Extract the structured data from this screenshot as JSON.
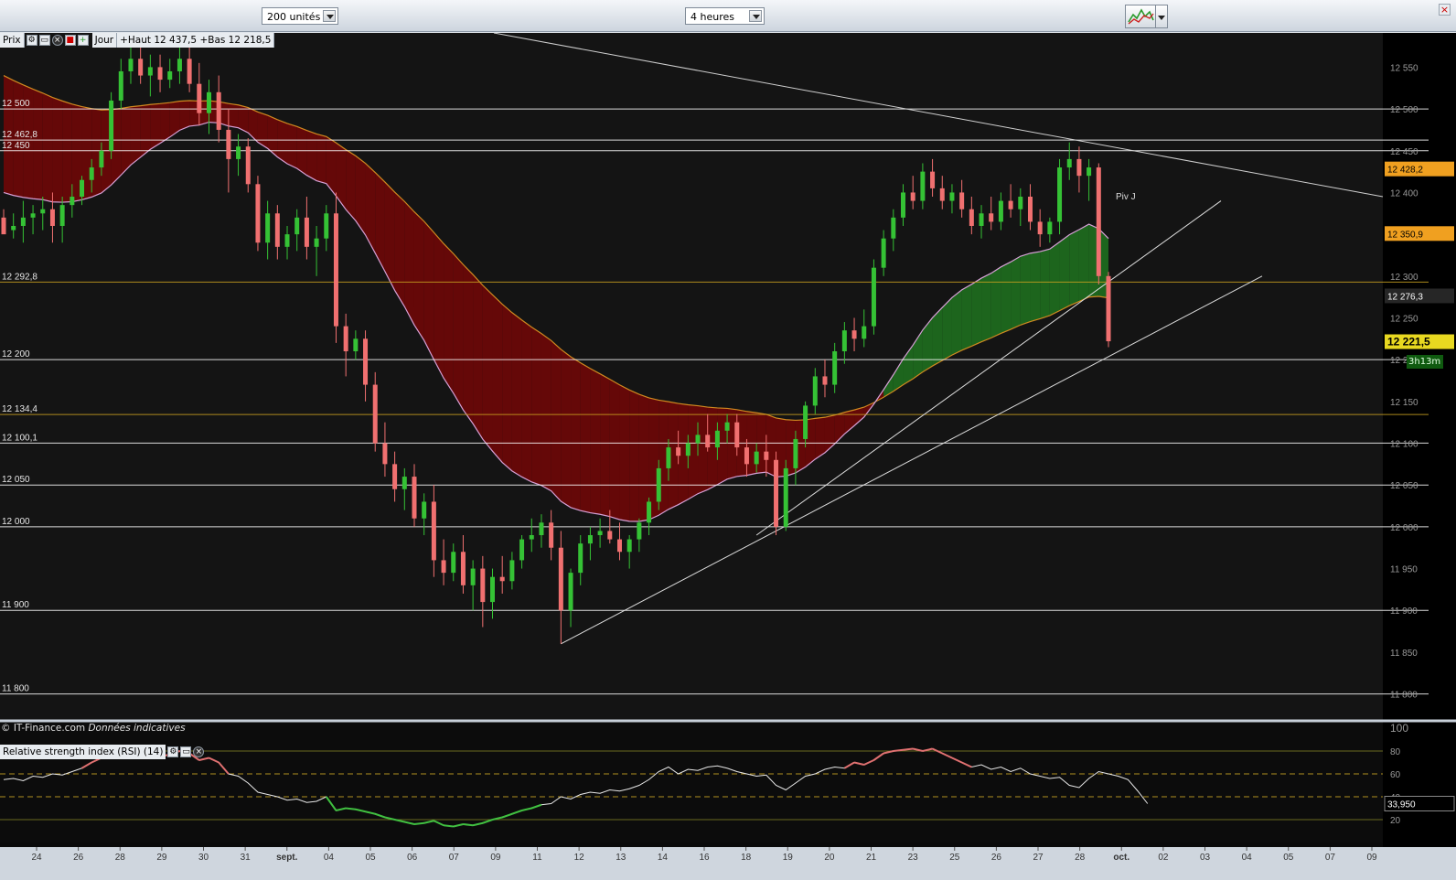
{
  "toolbar": {
    "units_select": "200 unités",
    "period_select": "4 heures",
    "close_label": "×"
  },
  "legend": {
    "price_label": "Prix",
    "period": "Jour",
    "high_low": "+Haut 12 437,5 +Bas 12 218,5"
  },
  "rsi_legend": {
    "label": "Relative strength index (RSI) (14)"
  },
  "footer": {
    "source": "© IT-Finance.com",
    "disclaimer": "Données indicatives"
  },
  "countdown": "3h13m",
  "colors": {
    "bull": "#35c235",
    "bear": "#f07070",
    "bull_fill": "#1e6e1e",
    "bear_fill": "#6e0707",
    "ma_orange": "#d08a20",
    "ma_pink": "#d6a0d6",
    "level_line": "#ffffff",
    "pivot_line": "#c8a020"
  },
  "chart_data": {
    "type": "candlestick",
    "timeframe": "4 heures",
    "ylim": [
      11770,
      12580
    ],
    "y_ticks": [
      12550,
      12500,
      12450,
      12400,
      12350,
      12300,
      12250,
      12200,
      12150,
      12100,
      12050,
      12000,
      11950,
      11900,
      11850,
      11800
    ],
    "y_tick_labels": [
      "12 550",
      "12 500",
      "12 450",
      "12 400",
      "12 350",
      "12 300",
      "12 250",
      "12 200",
      "12 150",
      "12 100",
      "12 050",
      "12 000",
      "11 950",
      "11 900",
      "11 850",
      "11 800"
    ],
    "x_tick_labels": [
      "24",
      "26",
      "28",
      "29",
      "30",
      "31",
      "sept.",
      "04",
      "05",
      "06",
      "07",
      "09",
      "11",
      "12",
      "13",
      "14",
      "16",
      "18",
      "19",
      "20",
      "21",
      "23",
      "25",
      "26",
      "27",
      "28",
      "oct.",
      "02",
      "03",
      "04",
      "05",
      "07",
      "09"
    ],
    "horizontal_levels": [
      {
        "label": "12 500",
        "value": 12500,
        "color": "white"
      },
      {
        "label": "12 462,8",
        "value": 12462.8,
        "color": "white"
      },
      {
        "label": "12 450",
        "value": 12450,
        "color": "white"
      },
      {
        "label": "12 292,8",
        "value": 12292.8,
        "color": "orange"
      },
      {
        "label": "12 200",
        "value": 12200,
        "color": "white"
      },
      {
        "label": "12 134,4",
        "value": 12134.4,
        "color": "orange"
      },
      {
        "label": "12 100,1",
        "value": 12100.1,
        "color": "white"
      },
      {
        "label": "12 050",
        "value": 12050,
        "color": "white"
      },
      {
        "label": "12 000",
        "value": 12000,
        "color": "white"
      },
      {
        "label": "11 900",
        "value": 11900,
        "color": "white"
      },
      {
        "label": "11 800",
        "value": 11800,
        "color": "white"
      }
    ],
    "price_tags": [
      {
        "label": "12 428,2",
        "value": 12428.2
      },
      {
        "label": "12 350,9",
        "value": 12350.9
      },
      {
        "label": "12 276,3",
        "value": 12276.3
      },
      {
        "label": "12 221,5",
        "value": 12221.5
      }
    ],
    "pivot_label": "Piv J",
    "candles": [
      [
        12370,
        12380,
        12355,
        12350
      ],
      [
        12355,
        12375,
        12345,
        12360
      ],
      [
        12360,
        12390,
        12340,
        12370
      ],
      [
        12370,
        12385,
        12350,
        12375
      ],
      [
        12375,
        12395,
        12355,
        12380
      ],
      [
        12380,
        12400,
        12340,
        12360
      ],
      [
        12360,
        12395,
        12340,
        12385
      ],
      [
        12385,
        12410,
        12370,
        12395
      ],
      [
        12395,
        12420,
        12385,
        12415
      ],
      [
        12415,
        12440,
        12400,
        12430
      ],
      [
        12430,
        12460,
        12420,
        12450
      ],
      [
        12450,
        12520,
        12440,
        12510
      ],
      [
        12510,
        12560,
        12500,
        12545
      ],
      [
        12545,
        12575,
        12530,
        12560
      ],
      [
        12560,
        12580,
        12530,
        12540
      ],
      [
        12540,
        12565,
        12515,
        12550
      ],
      [
        12550,
        12565,
        12520,
        12535
      ],
      [
        12535,
        12560,
        12525,
        12545
      ],
      [
        12545,
        12575,
        12530,
        12560
      ],
      [
        12560,
        12580,
        12520,
        12530
      ],
      [
        12530,
        12555,
        12480,
        12495
      ],
      [
        12495,
        12535,
        12470,
        12520
      ],
      [
        12520,
        12540,
        12460,
        12475
      ],
      [
        12475,
        12500,
        12400,
        12440
      ],
      [
        12440,
        12470,
        12420,
        12455
      ],
      [
        12455,
        12465,
        12400,
        12410
      ],
      [
        12410,
        12420,
        12330,
        12340
      ],
      [
        12340,
        12390,
        12320,
        12375
      ],
      [
        12375,
        12385,
        12320,
        12335
      ],
      [
        12335,
        12360,
        12320,
        12350
      ],
      [
        12350,
        12380,
        12330,
        12370
      ],
      [
        12370,
        12395,
        12320,
        12335
      ],
      [
        12335,
        12360,
        12300,
        12345
      ],
      [
        12345,
        12385,
        12330,
        12375
      ],
      [
        12375,
        12400,
        12220,
        12240
      ],
      [
        12240,
        12255,
        12180,
        12210
      ],
      [
        12210,
        12235,
        12200,
        12225
      ],
      [
        12225,
        12235,
        12150,
        12170
      ],
      [
        12170,
        12185,
        12090,
        12100
      ],
      [
        12100,
        12125,
        12060,
        12075
      ],
      [
        12075,
        12090,
        12030,
        12045
      ],
      [
        12045,
        12070,
        12020,
        12060
      ],
      [
        12060,
        12075,
        12000,
        12010
      ],
      [
        12010,
        12040,
        11990,
        12030
      ],
      [
        12030,
        12050,
        11940,
        11960
      ],
      [
        11960,
        11985,
        11930,
        11945
      ],
      [
        11945,
        11980,
        11935,
        11970
      ],
      [
        11970,
        11990,
        11920,
        11930
      ],
      [
        11930,
        11960,
        11900,
        11950
      ],
      [
        11950,
        11965,
        11880,
        11910
      ],
      [
        11910,
        11950,
        11890,
        11940
      ],
      [
        11940,
        11965,
        11920,
        11935
      ],
      [
        11935,
        11970,
        11925,
        11960
      ],
      [
        11960,
        11990,
        11950,
        11985
      ],
      [
        11985,
        12010,
        11970,
        11990
      ],
      [
        11990,
        12015,
        11975,
        12005
      ],
      [
        12005,
        12020,
        11960,
        11975
      ],
      [
        11975,
        11995,
        11860,
        11900
      ],
      [
        11900,
        11950,
        11880,
        11945
      ],
      [
        11945,
        11990,
        11930,
        11980
      ],
      [
        11980,
        12000,
        11960,
        11990
      ],
      [
        11990,
        12010,
        11975,
        11995
      ],
      [
        11995,
        12020,
        11980,
        11985
      ],
      [
        11985,
        12005,
        11960,
        11970
      ],
      [
        11970,
        11990,
        11950,
        11985
      ],
      [
        11985,
        12010,
        11970,
        12005
      ],
      [
        12005,
        12035,
        11990,
        12030
      ],
      [
        12030,
        12080,
        12020,
        12070
      ],
      [
        12070,
        12105,
        12055,
        12095
      ],
      [
        12095,
        12115,
        12075,
        12085
      ],
      [
        12085,
        12110,
        12070,
        12100
      ],
      [
        12100,
        12125,
        12085,
        12110
      ],
      [
        12110,
        12135,
        12090,
        12095
      ],
      [
        12095,
        12125,
        12080,
        12115
      ],
      [
        12115,
        12135,
        12100,
        12125
      ],
      [
        12125,
        12135,
        12085,
        12095
      ],
      [
        12095,
        12105,
        12060,
        12075
      ],
      [
        12075,
        12100,
        12065,
        12090
      ],
      [
        12090,
        12110,
        12060,
        12080
      ],
      [
        12080,
        12090,
        11990,
        12000
      ],
      [
        12000,
        12080,
        11995,
        12070
      ],
      [
        12070,
        12115,
        12050,
        12105
      ],
      [
        12105,
        12150,
        12095,
        12145
      ],
      [
        12145,
        12190,
        12135,
        12180
      ],
      [
        12180,
        12200,
        12155,
        12170
      ],
      [
        12170,
        12220,
        12160,
        12210
      ],
      [
        12210,
        12245,
        12195,
        12235
      ],
      [
        12235,
        12250,
        12210,
        12225
      ],
      [
        12225,
        12260,
        12215,
        12240
      ],
      [
        12240,
        12320,
        12230,
        12310
      ],
      [
        12310,
        12355,
        12300,
        12345
      ],
      [
        12345,
        12380,
        12330,
        12370
      ],
      [
        12370,
        12410,
        12360,
        12400
      ],
      [
        12400,
        12420,
        12380,
        12390
      ],
      [
        12390,
        12435,
        12380,
        12425
      ],
      [
        12425,
        12440,
        12395,
        12405
      ],
      [
        12405,
        12420,
        12380,
        12390
      ],
      [
        12390,
        12410,
        12375,
        12400
      ],
      [
        12400,
        12415,
        12370,
        12380
      ],
      [
        12380,
        12395,
        12350,
        12360
      ],
      [
        12360,
        12385,
        12345,
        12375
      ],
      [
        12375,
        12395,
        12355,
        12365
      ],
      [
        12365,
        12400,
        12355,
        12390
      ],
      [
        12390,
        12410,
        12370,
        12380
      ],
      [
        12380,
        12405,
        12360,
        12395
      ],
      [
        12395,
        12410,
        12355,
        12365
      ],
      [
        12365,
        12380,
        12335,
        12350
      ],
      [
        12350,
        12370,
        12340,
        12365
      ],
      [
        12365,
        12440,
        12350,
        12430
      ],
      [
        12430,
        12460,
        12415,
        12440
      ],
      [
        12440,
        12455,
        12400,
        12420
      ],
      [
        12420,
        12440,
        12390,
        12430
      ],
      [
        12430,
        12435,
        12290,
        12300
      ],
      [
        12300,
        12305,
        12215,
        12222
      ]
    ]
  },
  "rsi_data": {
    "period": 14,
    "ylim": [
      0,
      100
    ],
    "y_ticks": [
      100,
      80,
      60,
      40,
      20
    ],
    "y_tick_labels": [
      "100",
      "80",
      "60",
      "40",
      "20"
    ],
    "last_value_label": "33,950",
    "values": [
      55,
      56,
      54,
      58,
      57,
      60,
      59,
      62,
      65,
      70,
      74,
      79,
      82,
      83,
      80,
      76,
      75,
      77,
      80,
      78,
      72,
      74,
      70,
      60,
      58,
      52,
      44,
      42,
      40,
      37,
      38,
      35,
      36,
      40,
      28,
      30,
      29,
      27,
      25,
      22,
      20,
      18,
      16,
      17,
      19,
      15,
      14,
      16,
      15,
      17,
      20,
      22,
      25,
      28,
      30,
      33,
      34,
      40,
      38,
      42,
      44,
      43,
      46,
      45,
      47,
      50,
      55,
      62,
      66,
      60,
      64,
      63,
      66,
      67,
      65,
      62,
      60,
      58,
      59,
      50,
      46,
      52,
      58,
      60,
      64,
      66,
      65,
      70,
      68,
      72,
      78,
      80,
      81,
      82,
      80,
      82,
      78,
      74,
      70,
      66,
      68,
      64,
      66,
      62,
      65,
      60,
      58,
      56,
      57,
      50,
      48,
      56,
      62,
      60,
      58,
      55,
      45,
      34
    ]
  }
}
